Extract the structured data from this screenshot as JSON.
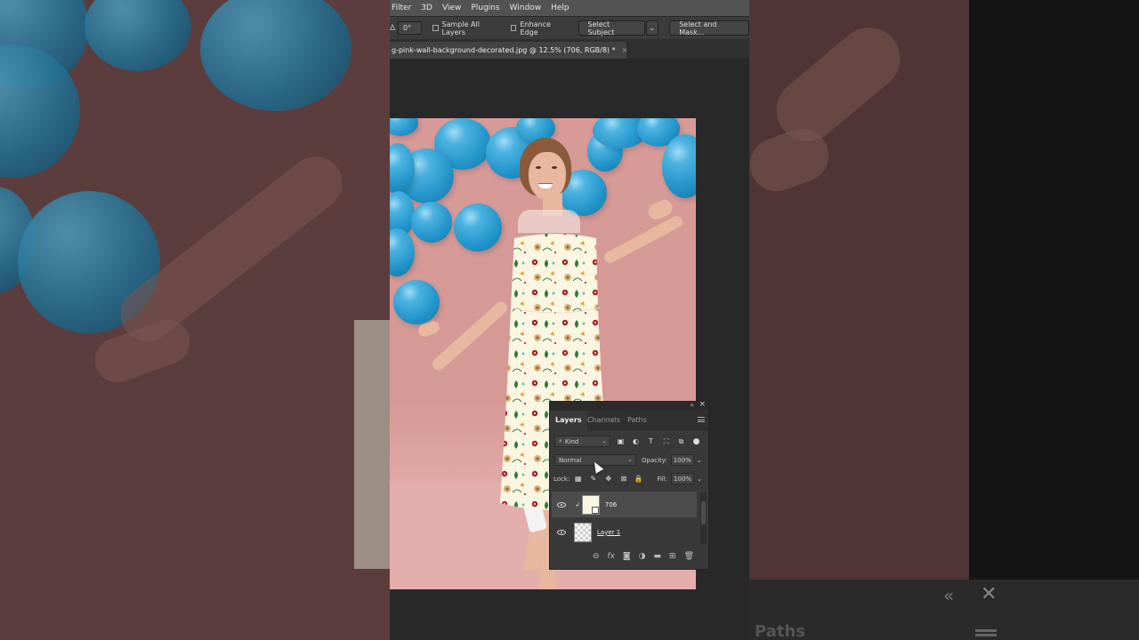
{
  "menubar": {
    "items": [
      "Filter",
      "3D",
      "View",
      "Plugins",
      "Window",
      "Help"
    ]
  },
  "options_bar": {
    "angle_value": "0°",
    "sample_all_layers": "Sample All Layers",
    "enhance_edge": "Enhance Edge",
    "select_subject": "Select Subject",
    "select_and_mask": "Select and Mask..."
  },
  "document_tab": {
    "title": "g-pink-wall-background-decorated.jpg @ 12.5% (706, RGB/8) *",
    "close": "×"
  },
  "layers_panel": {
    "tabs": [
      "Layers",
      "Channels",
      "Paths"
    ],
    "filter_kind": "Kind",
    "blend_mode": "Normal",
    "opacity_label": "Opacity:",
    "opacity_value": "100%",
    "lock_label": "Lock:",
    "fill_label": "Fill:",
    "fill_value": "100%",
    "layers": [
      {
        "name": "706",
        "visible": true,
        "selected": true
      },
      {
        "name": "Layer 1",
        "visible": true,
        "selected": false
      }
    ],
    "footer_icons": [
      "link-icon",
      "fx-icon",
      "mask-icon",
      "adjustment-icon",
      "folder-icon",
      "new-layer-icon",
      "trash-icon"
    ]
  },
  "background_panel": {
    "tab": "Paths"
  },
  "colors": {
    "wall": "#d79a97",
    "balloon": "#2496cc",
    "dress": "#fbf6e2",
    "ps_bg": "#282828"
  }
}
